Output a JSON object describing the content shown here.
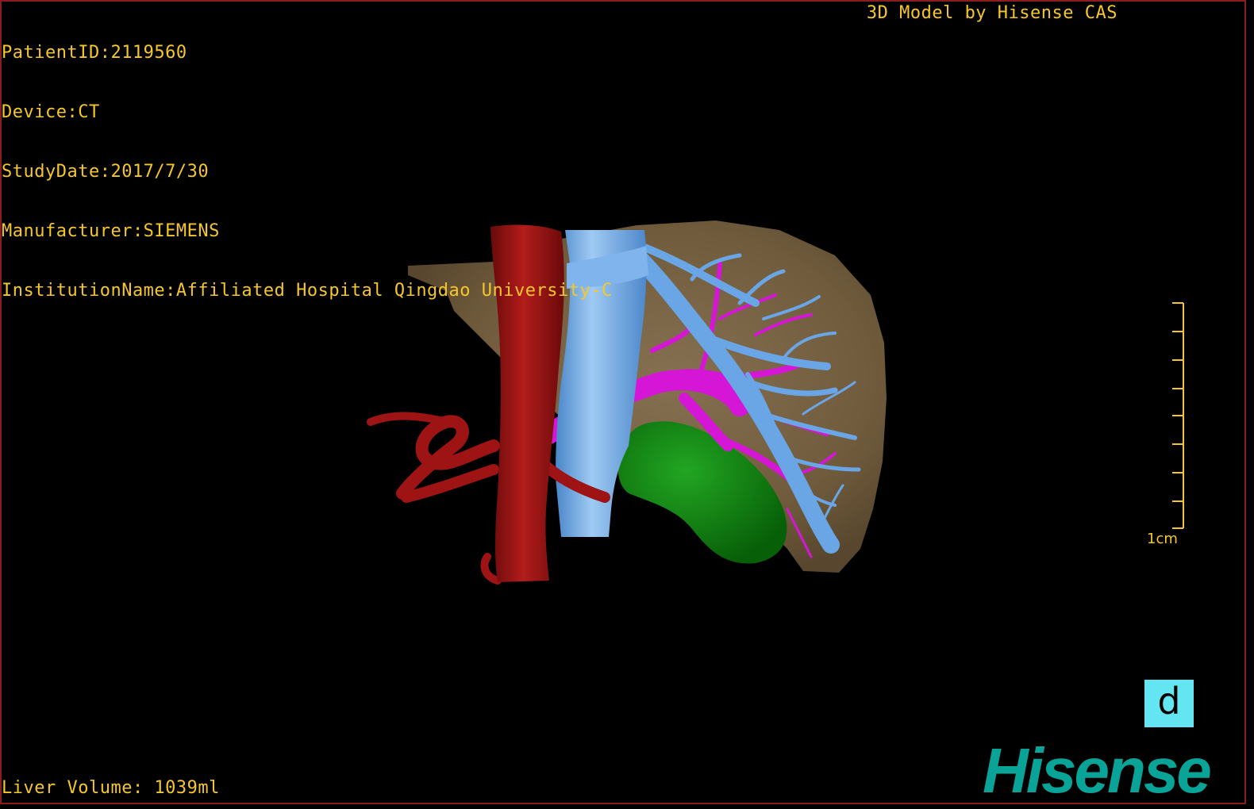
{
  "overlay": {
    "patient_id": "PatientID:2119560",
    "device": "Device:CT",
    "study_date": "StudyDate:2017/7/30",
    "manufacturer": "Manufacturer:SIEMENS",
    "institution": "InstitutionName:Affiliated Hospital Qingdao University-C",
    "credit": "3D Model by Hisense CAS",
    "liver_volume": "Liver Volume: 1039ml"
  },
  "scale_bar": {
    "label": "1cm",
    "ticks": 9
  },
  "view_button": {
    "label": "d"
  },
  "brand": {
    "name": "Hisense"
  },
  "colors": {
    "overlay_text": "#f6c72a",
    "liver": "#7b6548",
    "aorta": "#9e1414",
    "vena_cava": "#6aa6e6",
    "portal_vein": "#d616d6",
    "gallbladder": "#0f8a0f",
    "view_button": "#63e5f2",
    "brand": "#0aa397",
    "frame": "#8a1d1d"
  }
}
